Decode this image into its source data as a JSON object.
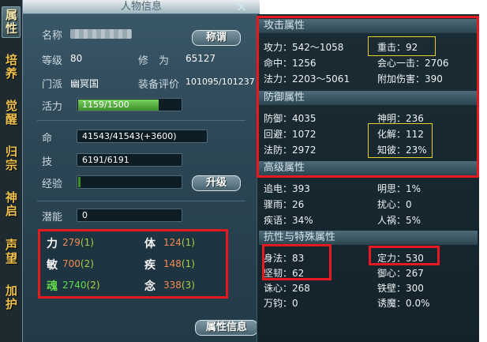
{
  "side_tabs": [
    "属性",
    "培养",
    "觉醒",
    "归宗",
    "神启",
    "声望",
    "加护"
  ],
  "panel_title": "人物信息",
  "close_icon": "×",
  "name_label": "名称",
  "title_button": "称谓",
  "level_label": "等级",
  "level_value": "80",
  "cultivation_label": "修　为",
  "cultivation_value": "65127",
  "sect_label": "门派",
  "sect_value": "幽冥国",
  "gear_label": "装备评价",
  "gear_value": "101095/101237",
  "vigor_label": "活力",
  "vigor_value": "1159/1500",
  "vigor_fraction": 0.773,
  "life_label": "命",
  "life_value": "41543/41543(+3600)",
  "skill_label": "技",
  "skill_value": "6191/6191",
  "exp_label": "经验",
  "level_up_button": "升级",
  "potential_label": "潜能",
  "potential_value": "0",
  "attributes": [
    {
      "name": "力",
      "value": "279",
      "bonus": "(1)",
      "color": "#f4f4f4"
    },
    {
      "name": "体",
      "value": "124",
      "bonus": "(1)",
      "color": "#f4f4f4"
    },
    {
      "name": "敏",
      "value": "700",
      "bonus": "(2)",
      "color": "#f4f4f4"
    },
    {
      "name": "疾",
      "value": "148",
      "bonus": "(1)",
      "color": "#f4f4f4"
    },
    {
      "name": "魂",
      "value": "2740",
      "bonus": "(2)",
      "color": "#63d94c"
    },
    {
      "name": "念",
      "value": "338",
      "bonus": "(3)",
      "color": "#f4f4f4"
    }
  ],
  "attr_info_button": "属性信息",
  "stats": {
    "attack_header": "攻击属性",
    "attack": [
      "攻力：542～1058",
      "重击：92",
      "命中：1256",
      "会心一击：2706",
      "法力：2203～5061",
      "附加伤害：390"
    ],
    "defense_header": "防御属性",
    "defense": [
      "防御：4035",
      "神明：236",
      "回避：1072",
      "化解：112",
      "法防：2972",
      "知彼：23%"
    ],
    "advanced_header": "高级属性",
    "advanced": [
      "追电：393",
      "明思：1%",
      "骤雨：26",
      "扰心：0",
      "疾语：34%",
      "人祸：5%"
    ],
    "resist_header": "抗性与特殊属性",
    "resist": [
      "身法：83",
      "定力：530",
      "坚韧：62",
      "御心：267",
      "诛心：268",
      "铁壁：300",
      "万钧：0",
      "诱魔：0.0%"
    ]
  },
  "colors": {
    "highlight_red": "#e5191f",
    "highlight_yellow": "#e5d02a"
  }
}
